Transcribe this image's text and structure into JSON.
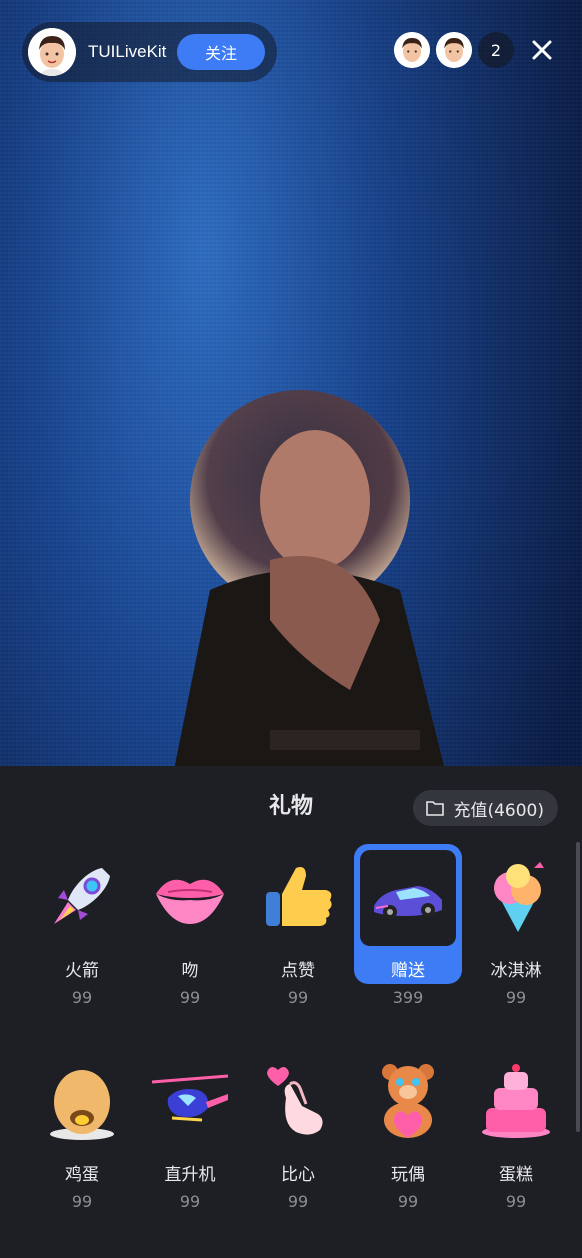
{
  "host": {
    "name": "TUILiveKit",
    "follow_label": "关注"
  },
  "audience": {
    "count": "2"
  },
  "gift_panel": {
    "title": "礼物",
    "recharge_label": "充值(4600)",
    "gifts": [
      {
        "name": "火箭",
        "price": "99",
        "icon": "rocket-icon"
      },
      {
        "name": "吻",
        "price": "99",
        "icon": "kiss-lips-icon"
      },
      {
        "name": "点赞",
        "price": "99",
        "icon": "thumbs-up-icon"
      },
      {
        "name": "赠送",
        "price": "399",
        "icon": "sports-car-icon",
        "selected": true
      },
      {
        "name": "冰淇淋",
        "price": "99",
        "icon": "ice-cream-icon"
      },
      {
        "name": "鸡蛋",
        "price": "99",
        "icon": "egg-icon"
      },
      {
        "name": "直升机",
        "price": "99",
        "icon": "helicopter-icon"
      },
      {
        "name": "比心",
        "price": "99",
        "icon": "finger-heart-icon"
      },
      {
        "name": "玩偶",
        "price": "99",
        "icon": "teddy-bear-icon"
      },
      {
        "name": "蛋糕",
        "price": "99",
        "icon": "cake-icon"
      }
    ]
  },
  "colors": {
    "accent": "#3d7cf5",
    "panel_bg": "#1e1f24"
  }
}
